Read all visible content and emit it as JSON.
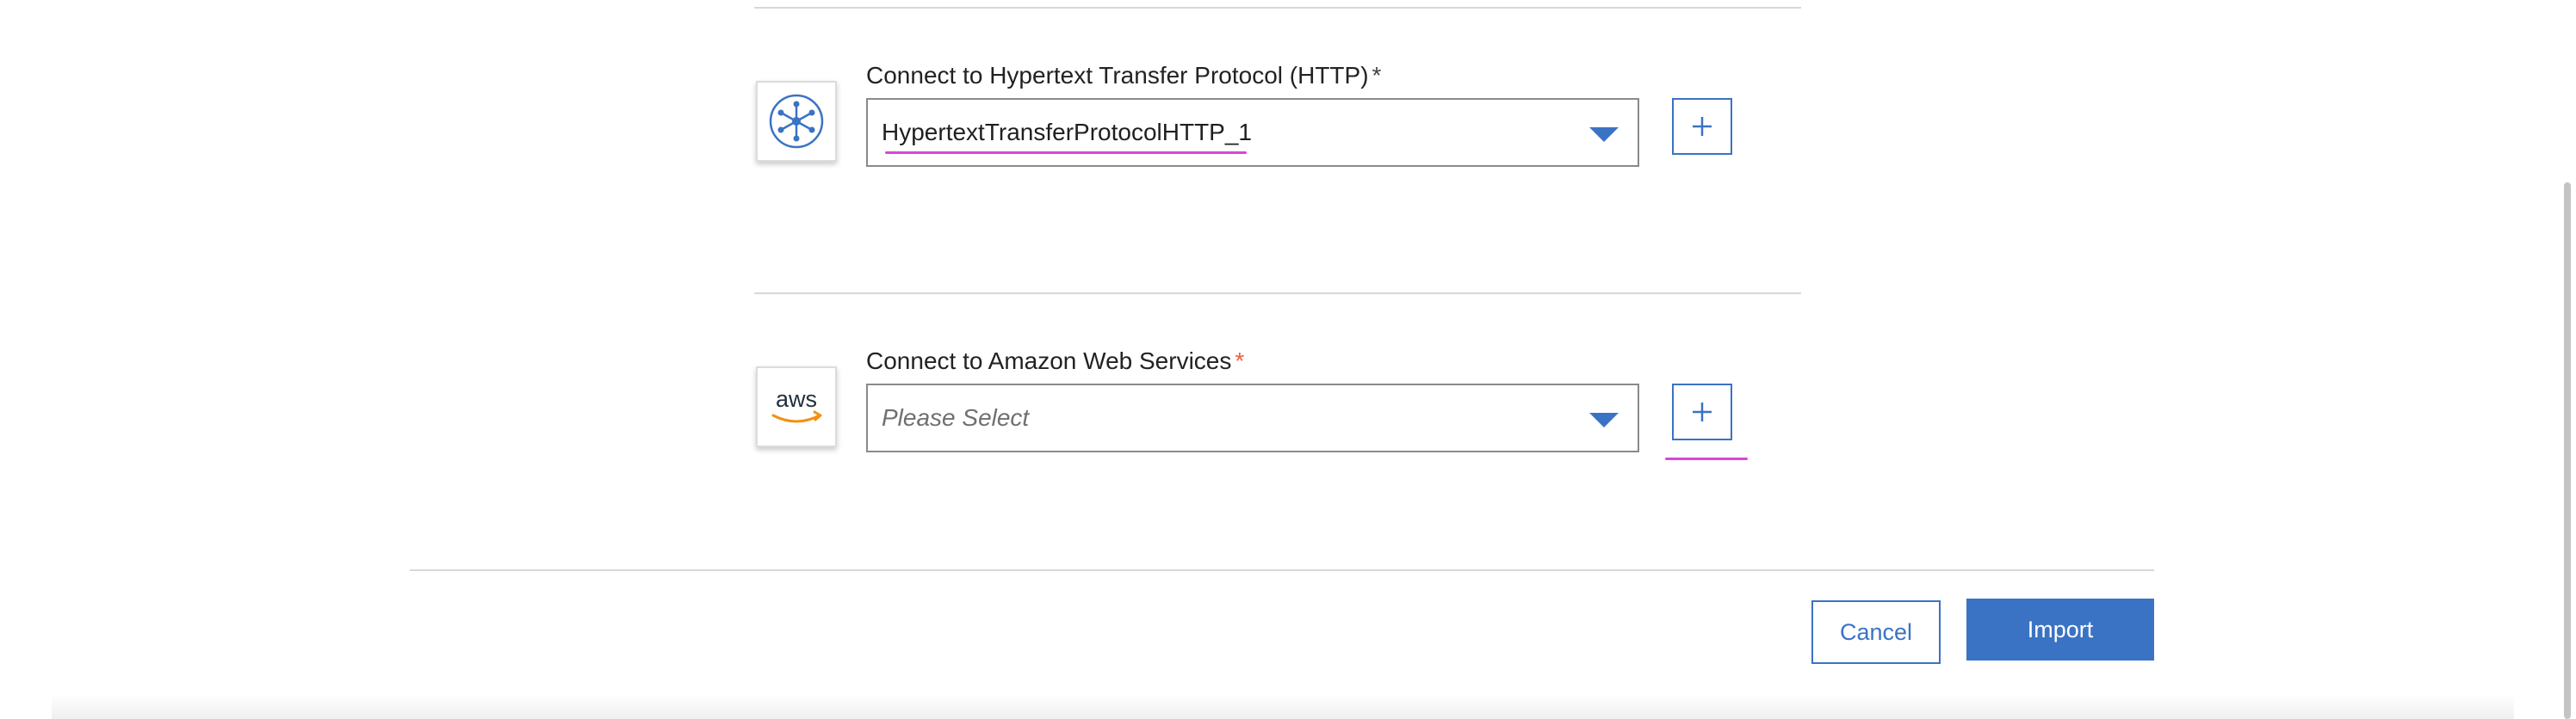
{
  "connections": [
    {
      "label": "Connect to Hypertext Transfer Protocol (HTTP)",
      "required_marker": "*",
      "icon": "http-network-icon",
      "selected_value": "HypertextTransferProtocolHTTP_1",
      "add_button_glyph": "+"
    },
    {
      "label": "Connect to Amazon Web Services",
      "required_marker": "*",
      "icon": "aws-logo-icon",
      "logo_text": "aws",
      "placeholder": "Please Select",
      "add_button_glyph": "+"
    }
  ],
  "footer": {
    "cancel_label": "Cancel",
    "import_label": "Import"
  },
  "colors": {
    "accent": "#3a73c4",
    "annotation": "#d946d9",
    "required_red": "#e8603c",
    "aws_orange": "#f29111"
  }
}
